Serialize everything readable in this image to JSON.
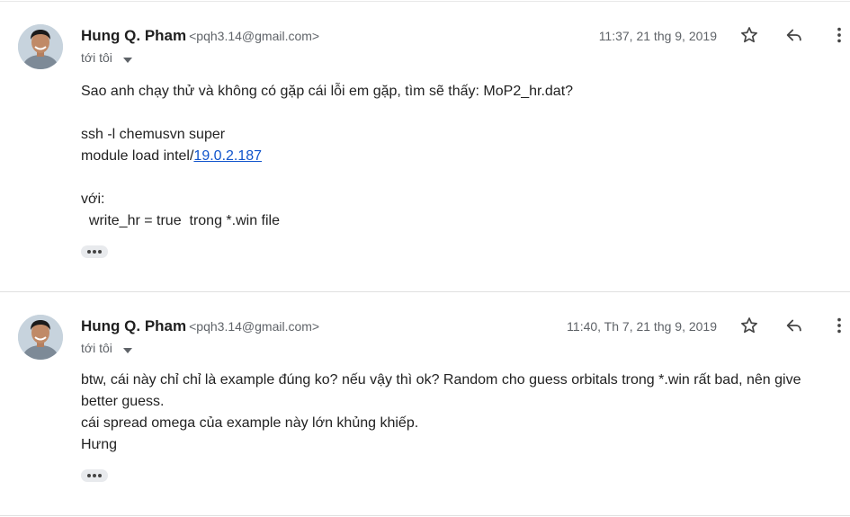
{
  "messages": [
    {
      "sender_name": "Hung Q. Pham",
      "sender_email": "<pqh3.14@gmail.com>",
      "timestamp": "11:37, 21 thg 9, 2019",
      "recipient": "tới tôi",
      "body": {
        "line1": "Sao anh chạy thử và không có gặp cái lỗi em gặp, tìm sẽ thấy: MoP2_hr.dat?",
        "line2": "ssh -l chemusvn super",
        "line3_prefix": "module load intel/",
        "line3_link": "19.0.2.187",
        "line4": "với:",
        "line5": "  write_hr = true  trong *.win file"
      }
    },
    {
      "sender_name": "Hung Q. Pham",
      "sender_email": "<pqh3.14@gmail.com>",
      "timestamp": "11:40, Th 7, 21 thg 9, 2019",
      "recipient": "tới tôi",
      "body": {
        "line1": "btw, cái này chỉ chỉ là example đúng ko? nếu vậy thì ok? Random cho guess orbitals trong *.win rất bad, nên give better guess.",
        "line2": "cái spread omega của example này lớn khủng khiếp.",
        "line3": "Hưng"
      }
    }
  ],
  "icons": {
    "star": "star-icon",
    "reply": "reply-icon",
    "more": "more-vert-icon",
    "caret": "caret-down-icon",
    "ellipsis": "show-trimmed-content-icon"
  },
  "colors": {
    "name": "#1f1f1f",
    "secondary": "#5f6368",
    "link": "#1155cc",
    "divider": "#e0e0e0"
  }
}
